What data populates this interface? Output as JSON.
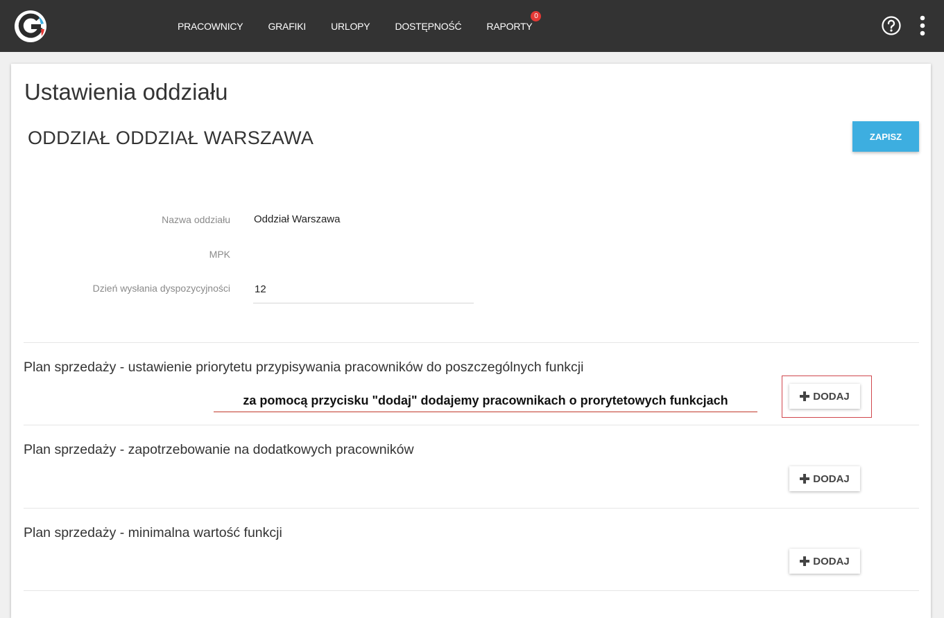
{
  "nav": {
    "items": [
      {
        "label": "PRACOWNICY"
      },
      {
        "label": "GRAFIKI"
      },
      {
        "label": "URLOPY"
      },
      {
        "label": "DOSTĘPNOŚĆ"
      },
      {
        "label": "RAPORTY",
        "badge": "0"
      }
    ]
  },
  "icons": {
    "logo": "app-logo",
    "help": "question-circle-icon",
    "menu": "vertical-dots-icon",
    "add": "plus-icon"
  },
  "colors": {
    "topbar": "#333333",
    "primary": "#3daee0",
    "badge": "#e53935",
    "annotation": "#c0392b"
  },
  "page": {
    "title": "Ustawienia oddziału",
    "branch_title": "ODDZIAŁ ODDZIAŁ WARSZAWA",
    "save_label": "ZAPISZ"
  },
  "form": {
    "name_label": "Nazwa oddziału",
    "name_value": "Oddział Warszawa",
    "mpk_label": "MPK",
    "mpk_value": "",
    "dispatch_day_label": "Dzień wysłania dyspozycyjności",
    "dispatch_day_value": "12"
  },
  "sections": [
    {
      "title": "Plan sprzedaży - ustawienie priorytetu przypisywania pracowników do poszczególnych funkcji",
      "add_label": "DODAJ"
    },
    {
      "title": "Plan sprzedaży - zapotrzebowanie na dodatkowych pracowników",
      "add_label": "DODAJ"
    },
    {
      "title": "Plan sprzedaży - minimalna wartość funkcji",
      "add_label": "DODAJ"
    }
  ],
  "annotation": {
    "text": "za pomocą przycisku \"dodaj\" dodajemy pracownikach o prorytetowych funkcjach"
  }
}
